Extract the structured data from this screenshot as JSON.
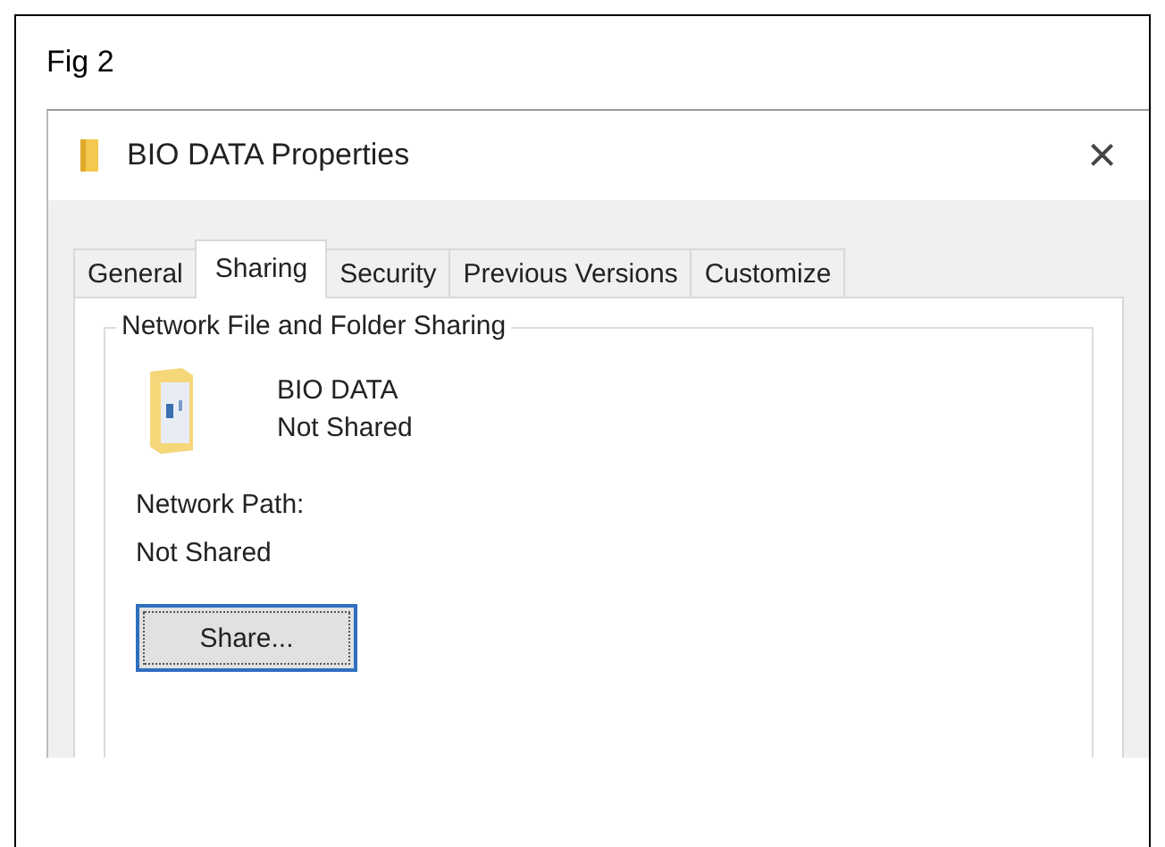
{
  "figure": {
    "caption": "Fig 2"
  },
  "window": {
    "title": "BIO DATA Properties",
    "close": "×"
  },
  "tabs": [
    {
      "label": "General",
      "selected": false
    },
    {
      "label": "Sharing",
      "selected": true
    },
    {
      "label": "Security",
      "selected": false
    },
    {
      "label": "Previous Versions",
      "selected": false
    },
    {
      "label": "Customize",
      "selected": false
    }
  ],
  "group": {
    "title": "Network File and Folder Sharing",
    "folder_name": "BIO DATA",
    "folder_status": "Not Shared",
    "path_label": "Network Path:",
    "path_value": "Not Shared",
    "button": "Share..."
  }
}
